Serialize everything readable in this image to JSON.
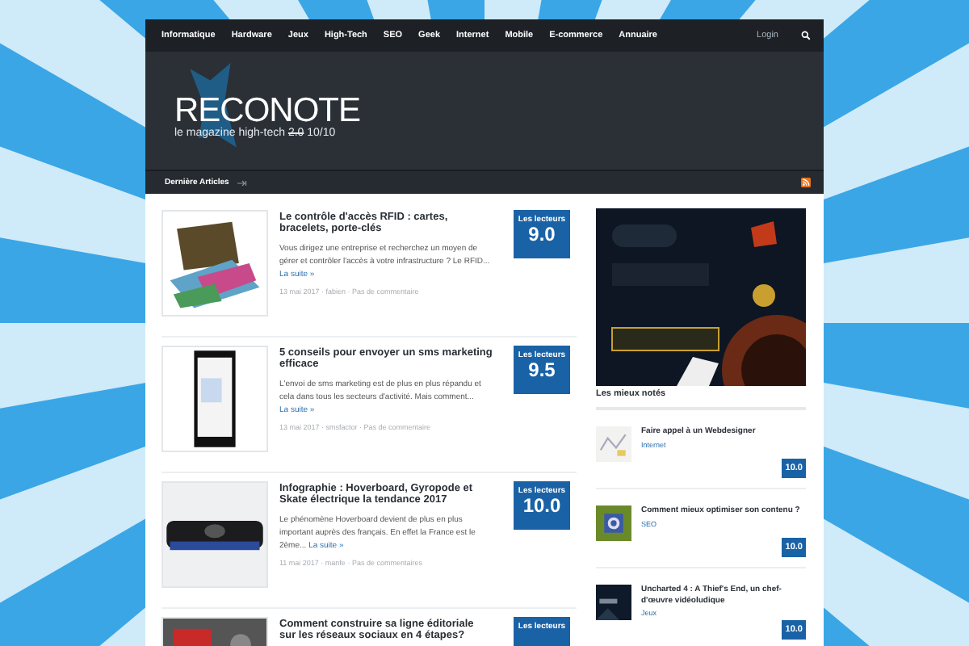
{
  "nav": {
    "items": [
      "Informatique",
      "Hardware",
      "Jeux",
      "High-Tech",
      "SEO",
      "Geek",
      "Internet",
      "Mobile",
      "E-commerce",
      "Annuaire"
    ],
    "login": "Login"
  },
  "header": {
    "logo": "RECONOTE",
    "tagline": {
      "before": "le magazine high-tech",
      "struck": "2.0",
      "after": "10/10"
    }
  },
  "subbar": {
    "label": "Dernière Articles"
  },
  "articles": [
    {
      "title": "Le contrôle d'accès RFID : cartes, bracelets, porte-clés",
      "excerpt": "Vous dirigez une entreprise et recherchez un moyen de gérer et contrôler l'accès à votre infrastructure ? Le RFID...",
      "more": "La suite »",
      "meta": "13 mai 2017 · fabien · Pas de commentaire",
      "score_label": "Les lecteurs",
      "score": "9.0"
    },
    {
      "title": "5 conseils pour envoyer un sms marketing efficace",
      "excerpt": "L'envoi de sms marketing est de plus en plus répandu et cela dans tous les secteurs d'activité. Mais comment...",
      "more": "La suite »",
      "meta": "13 mai 2017 · smsfactor · Pas de commentaire",
      "score_label": "Les lecteurs",
      "score": "9.5"
    },
    {
      "title": "Infographie : Hoverboard, Gyropode et Skate électrique la tendance 2017",
      "excerpt": "Le phénomène Hoverboard devient de plus en plus important auprès des français. En effet la France est le 2ème...",
      "more": "La suite »",
      "meta": "11 mai 2017 · manfe · Pas de commentaires",
      "score_label": "Les lecteurs",
      "score": "10.0"
    },
    {
      "title": "Comment construire sa ligne éditoriale sur les réseaux sociaux en 4 étapes?",
      "score_label": "Les lecteurs"
    }
  ],
  "sidebar": {
    "heading": "Les mieux notés",
    "items": [
      {
        "title": "Faire appel à un Webdesigner",
        "category": "Internet",
        "score": "10.0"
      },
      {
        "title": "Comment mieux optimiser son contenu ?",
        "category": "SEO",
        "score": "10.0"
      },
      {
        "title": "Uncharted 4 : A Thief's End, un chef-d'œuvre vidéoludique",
        "category": "Jeux",
        "score": "10.0"
      }
    ]
  }
}
